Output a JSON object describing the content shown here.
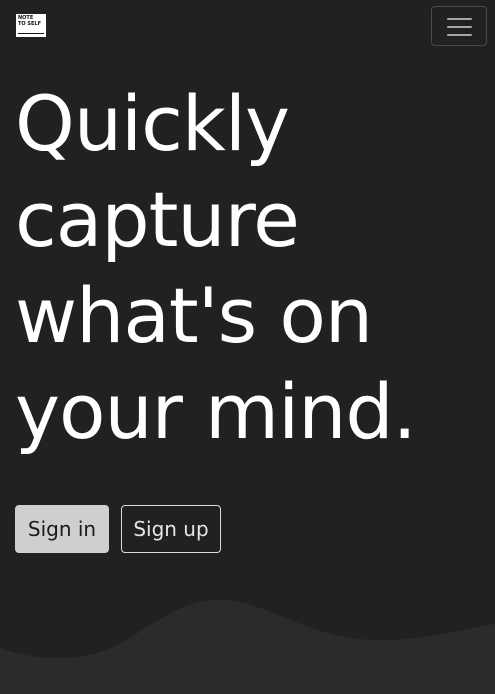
{
  "navbar": {
    "logo_line1": "NOTE",
    "logo_line2": "TO SELF",
    "menu_icon": "hamburger-menu-icon"
  },
  "hero": {
    "line1": "Quickly",
    "line2": "capture",
    "line3": "what's on",
    "line4": "your mind."
  },
  "actions": {
    "sign_in_label": "Sign in",
    "sign_up_label": "Sign up"
  },
  "colors": {
    "background": "#212121",
    "wave": "#2b2b2b",
    "text": "#ffffff",
    "sign_in_bg": "#cfcfcf"
  }
}
